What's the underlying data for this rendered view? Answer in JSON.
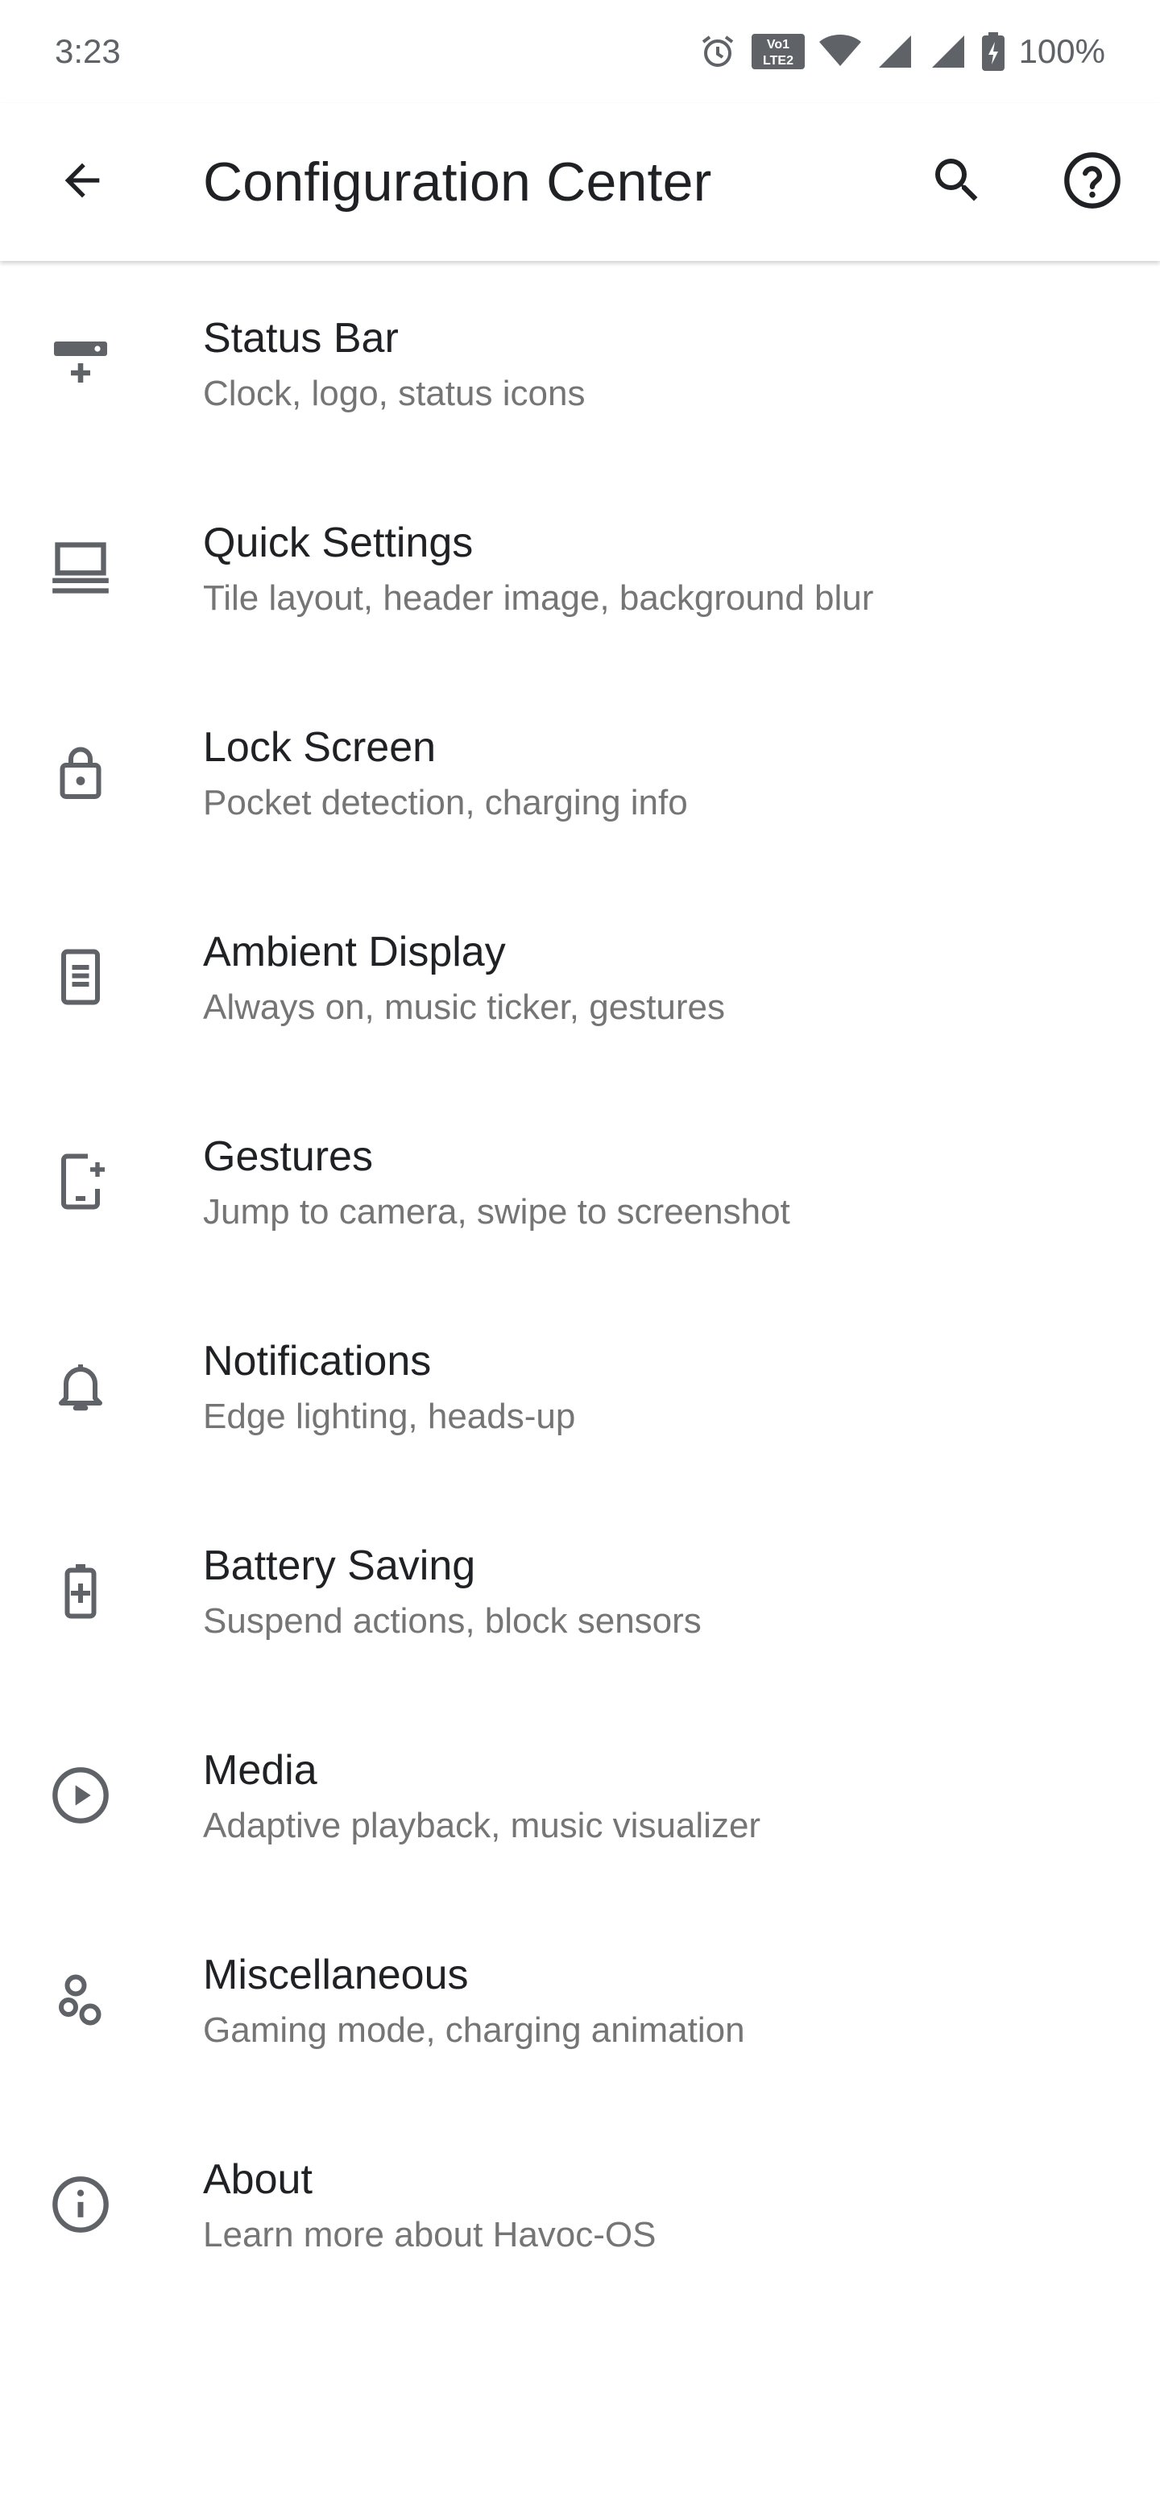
{
  "status_bar": {
    "time": "3:23",
    "battery": "100%",
    "icons": [
      "alarm-icon",
      "volte-icon",
      "wifi-icon",
      "signal-icon",
      "signal-icon",
      "battery-charging-icon"
    ]
  },
  "app_bar": {
    "title": "Configuration Center",
    "back_icon": "back-arrow-icon",
    "search_icon": "search-icon",
    "help_icon": "help-icon"
  },
  "items": [
    {
      "title": "Status Bar",
      "summary": "Clock, logo, status icons",
      "icon": "status-bar-icon"
    },
    {
      "title": "Quick Settings",
      "summary": "Tile layout, header image, background blur",
      "icon": "quick-settings-icon"
    },
    {
      "title": "Lock Screen",
      "summary": "Pocket detection, charging info",
      "icon": "lock-icon"
    },
    {
      "title": "Ambient Display",
      "summary": "Always on, music ticker, gestures",
      "icon": "ambient-display-icon"
    },
    {
      "title": "Gestures",
      "summary": "Jump to camera, swipe to screenshot",
      "icon": "gestures-icon"
    },
    {
      "title": "Notifications",
      "summary": "Edge lighting, heads-up",
      "icon": "bell-icon"
    },
    {
      "title": "Battery Saving",
      "summary": "Suspend actions, block sensors",
      "icon": "battery-plus-icon"
    },
    {
      "title": "Media",
      "summary": "Adaptive playback, music visualizer",
      "icon": "play-circle-icon"
    },
    {
      "title": "Miscellaneous",
      "summary": "Gaming mode, charging animation",
      "icon": "bubbles-icon"
    },
    {
      "title": "About",
      "summary": "Learn more about Havoc-OS",
      "icon": "info-icon"
    }
  ],
  "colors": {
    "icon": "#5f6368",
    "title": "#202124",
    "summary": "#757575"
  }
}
